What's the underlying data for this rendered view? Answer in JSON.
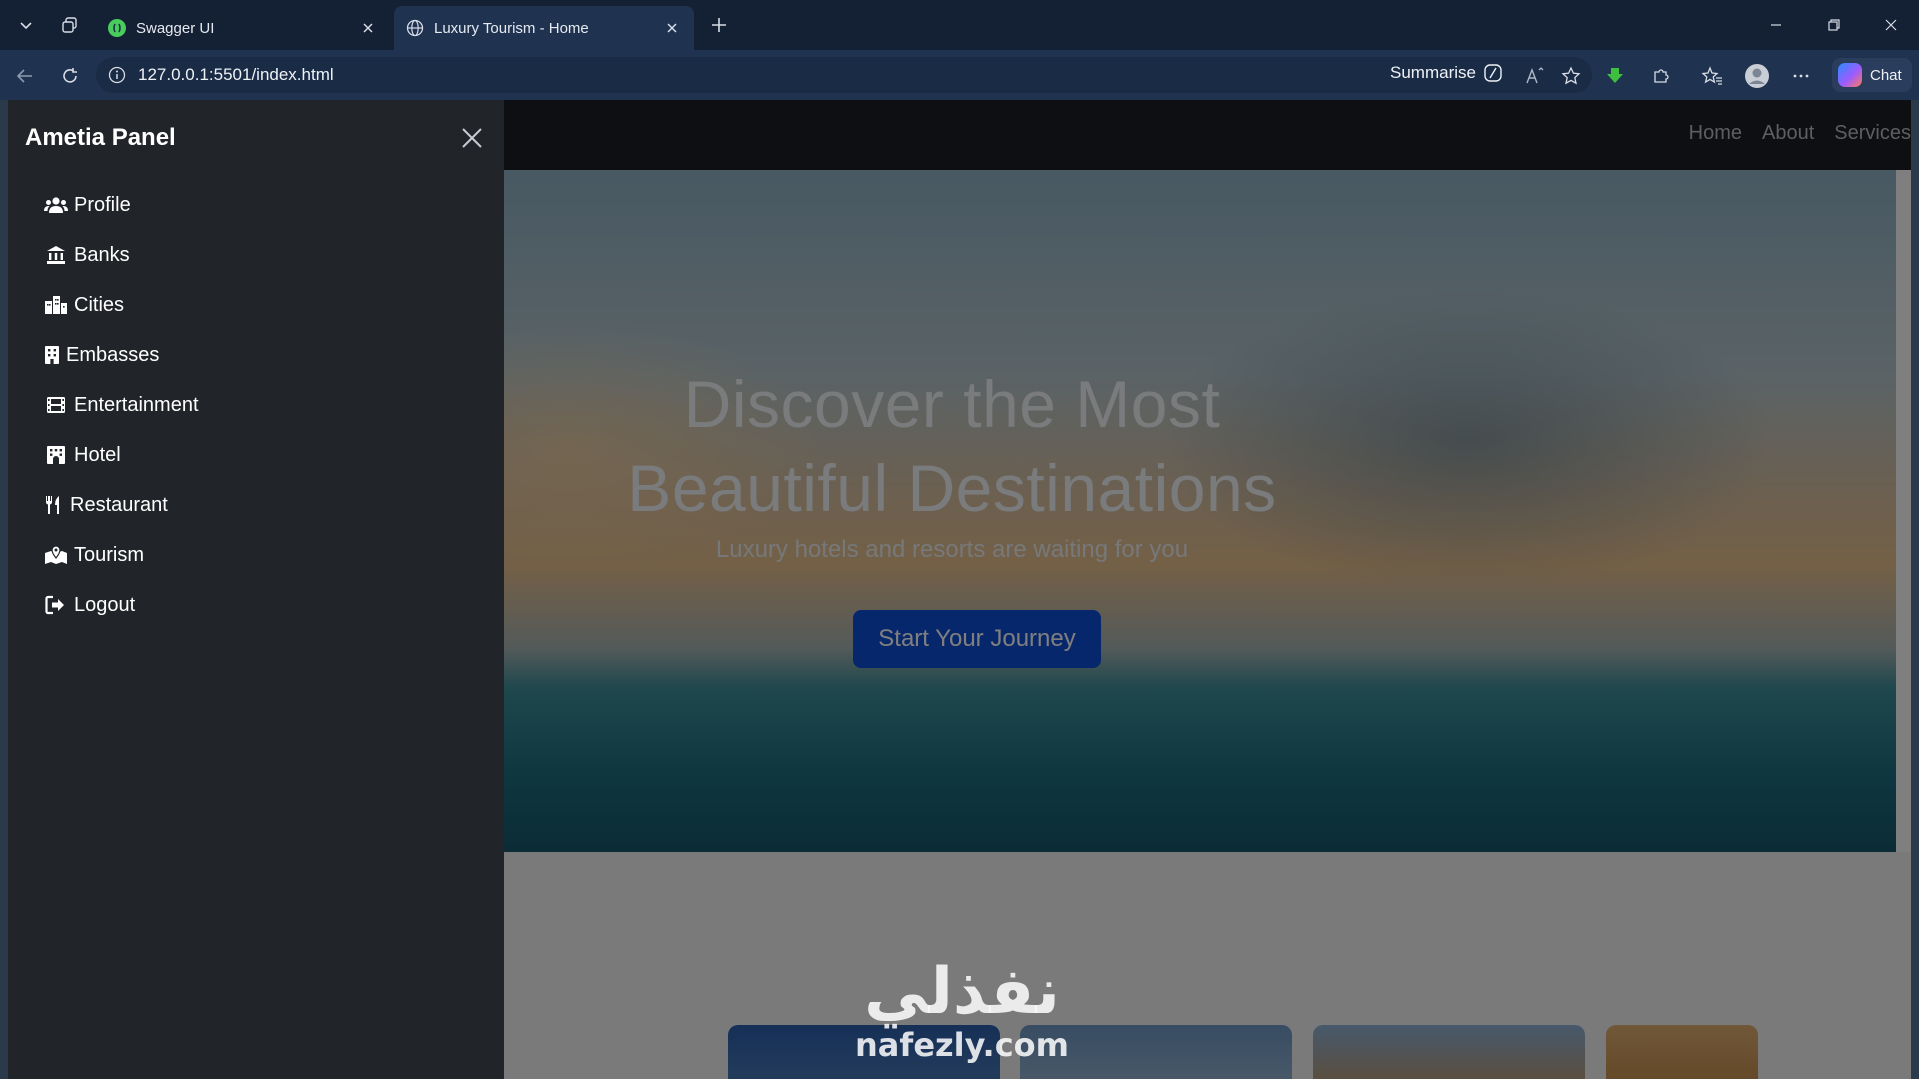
{
  "browser": {
    "tabs": [
      {
        "title": "Swagger UI",
        "active": false
      },
      {
        "title": "Luxury Tourism - Home",
        "active": true
      }
    ],
    "url": "127.0.0.1:5501/index.html",
    "summarise_label": "Summarise",
    "chat_label": "Chat"
  },
  "navbar": {
    "links": [
      "Home",
      "About",
      "Services"
    ]
  },
  "hero": {
    "title_line1": "Discover the Most",
    "title_line2": "Beautiful Destinations",
    "subtitle": "Luxury hotels and resorts are waiting for you",
    "cta_label": "Start Your Journey"
  },
  "panel": {
    "title": "Ametia Panel",
    "items": [
      {
        "label": "Profile",
        "icon": "users-icon"
      },
      {
        "label": "Banks",
        "icon": "bank-icon"
      },
      {
        "label": "Cities",
        "icon": "city-icon"
      },
      {
        "label": "Embasses",
        "icon": "building-icon"
      },
      {
        "label": "Entertainment",
        "icon": "film-icon"
      },
      {
        "label": "Hotel",
        "icon": "hotel-icon"
      },
      {
        "label": "Restaurant",
        "icon": "utensils-icon"
      },
      {
        "label": "Tourism",
        "icon": "map-location-icon"
      },
      {
        "label": "Logout",
        "icon": "logout-icon"
      }
    ]
  },
  "watermark": {
    "arabic": "نفذلي",
    "latin": "nafezly.com"
  }
}
